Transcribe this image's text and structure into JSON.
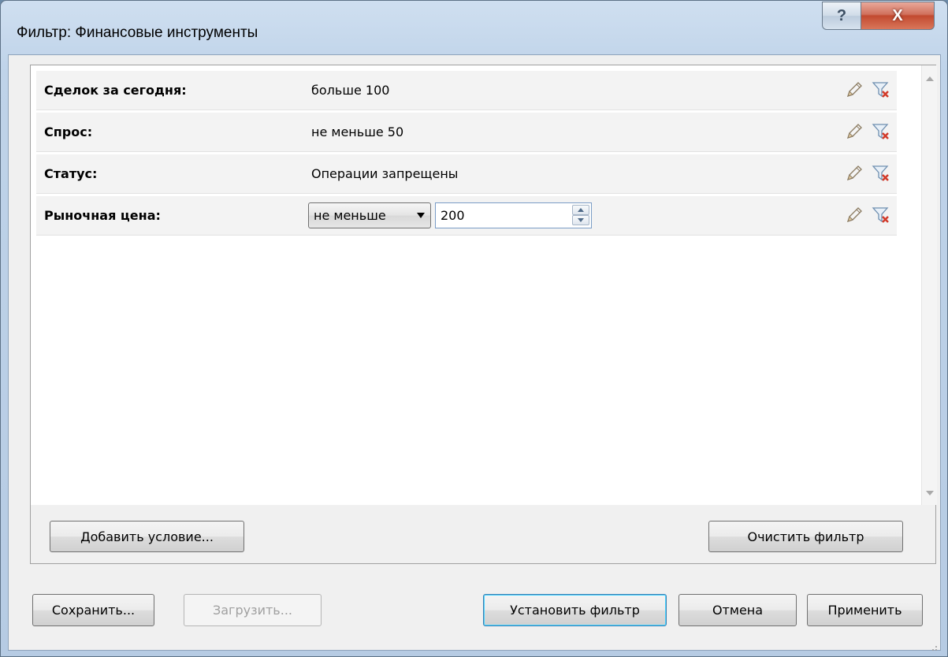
{
  "window": {
    "title": "Фильтр: Финансовые инструменты",
    "help_label": "?",
    "close_label": "X"
  },
  "conditions": [
    {
      "label": "Сделок за сегодня:",
      "value": "больше 100"
    },
    {
      "label": "Спрос:",
      "value": "не меньше 50"
    },
    {
      "label": "Статус:",
      "value": "Операции запрещены"
    },
    {
      "label": "Рыночная цена:",
      "operator": "не меньше",
      "input_value": "200"
    }
  ],
  "icons": {
    "edit": "pencil-icon",
    "remove": "filter-remove-icon"
  },
  "group_buttons": {
    "add_condition": "Добавить условие...",
    "clear_filter": "Очистить фильтр"
  },
  "footer": {
    "save": "Сохранить...",
    "load": "Загрузить...",
    "set_filter": "Установить фильтр",
    "cancel": "Отмена",
    "apply": "Применить"
  },
  "colors": {
    "close_button": "#c24a30",
    "title_bar": "#bfd3e9",
    "input_focus": "#7a9cc6"
  }
}
